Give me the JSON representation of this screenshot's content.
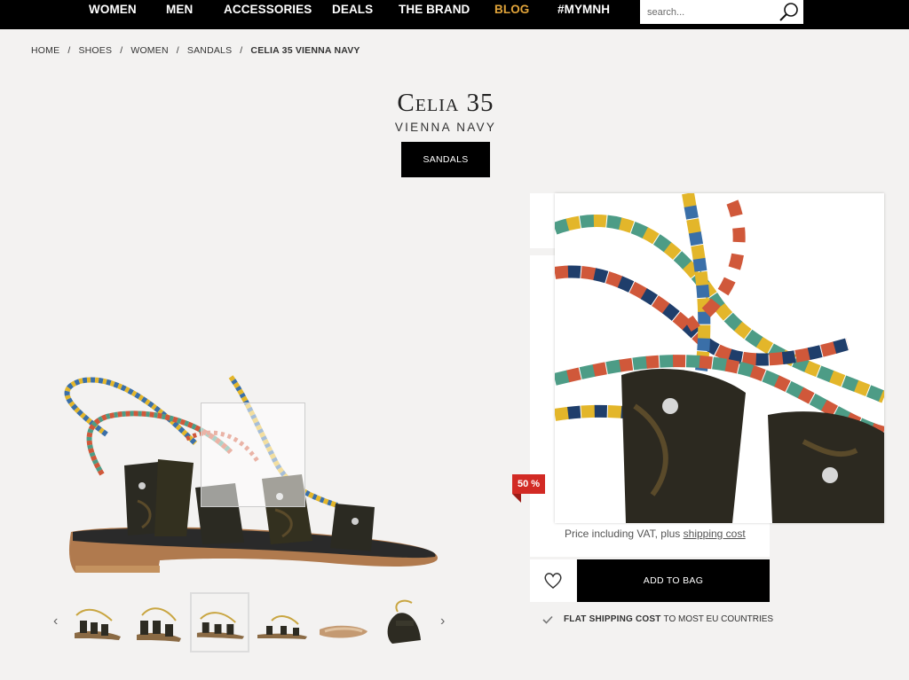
{
  "nav": {
    "items": [
      "WOMEN",
      "MEN",
      "ACCESSORIES",
      "DEALS",
      "THE BRAND",
      "BLOG",
      "#MYMNH"
    ],
    "accent_color": "#e1a43a",
    "search_placeholder": "search..."
  },
  "breadcrumb": [
    "HOME",
    "SHOES",
    "WOMEN",
    "SANDALS",
    "CELIA 35 VIENNA NAVY"
  ],
  "product": {
    "name": "Celia 35",
    "color_name": "VIENNA NAVY",
    "category_button": "SANDALS",
    "discount_badge": "50 %",
    "vat_text": "Price including VAT, plus",
    "shipping_link": "shipping cost",
    "add_to_bag": "ADD TO BAG",
    "shipping_bold": "FLAT SHIPPING COST",
    "shipping_rest": "TO MOST EU COUNTRIES"
  },
  "icons": [
    "search-icon",
    "heart-icon",
    "check-icon",
    "chevron-left-icon",
    "chevron-right-icon"
  ],
  "colors": {
    "badge": "#d22a24",
    "bar": "#000000",
    "background": "#f3f2f1"
  }
}
